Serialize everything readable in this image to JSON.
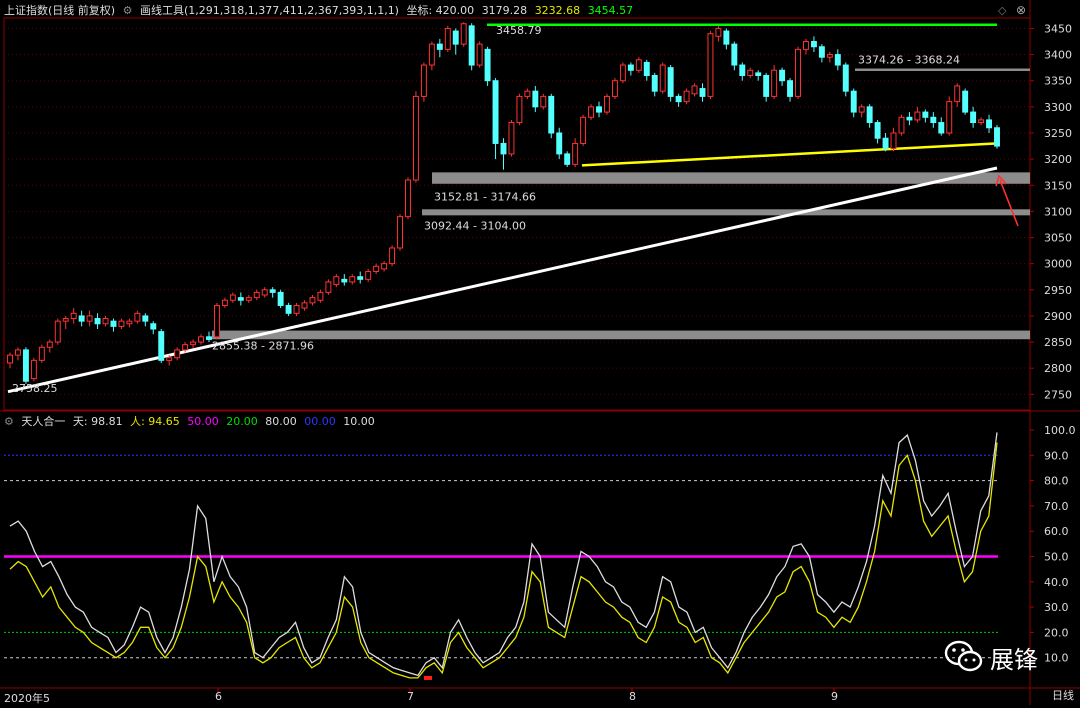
{
  "header": {
    "title": "上证指数(日线 前复权)",
    "tool": "画线工具(1,291,318,1,377,411,2,367,393,1,1,1)",
    "coord_label": "坐标: 420.00",
    "v1": "3179.28",
    "v2": "3232.68",
    "v3": "3454.57"
  },
  "indicator": {
    "name": "天人合一",
    "tian_label": "天: 98.81",
    "ren_label": "人: 94.65",
    "p50": "50.00",
    "p20": "20.00",
    "p80": "80.00",
    "p00": "00.00",
    "p10": "10.00"
  },
  "colors": {
    "up": "#ff3232",
    "down": "#54ffff",
    "tian": "#dddddd",
    "ren": "#e6e600",
    "magenta": "#ff00ff",
    "green": "#00ff00",
    "yellow": "#ffff00",
    "grey_band": "#8c8c8c"
  },
  "timeline": {
    "start": "2020年5",
    "labels": [
      "6",
      "7",
      "8",
      "9"
    ],
    "tab": "日线"
  },
  "watermark": "展锋",
  "chart_data": {
    "type": "candlestick",
    "price_ticks": [
      2750,
      2800,
      2850,
      2900,
      2950,
      3000,
      3050,
      3100,
      3150,
      3200,
      3250,
      3300,
      3350,
      3400,
      3450
    ],
    "price_range": [
      2720,
      3470
    ],
    "annotations": [
      {
        "text": "3458.79",
        "price": 3458.79
      },
      {
        "text": "3374.26 - 3368.24",
        "price": 3371
      },
      {
        "text": "3152.81 - 3174.66",
        "price": 3163
      },
      {
        "text": "3092.44 - 3104.00",
        "price": 3098
      },
      {
        "text": "2855.38 - 2871.96",
        "price": 2863
      },
      {
        "text": "2758.25",
        "price": 2758.25
      }
    ],
    "candles": [
      [
        2810,
        2825,
        2800,
        2830
      ],
      [
        2825,
        2835,
        2815,
        2840
      ],
      [
        2835,
        2775,
        2770,
        2840
      ],
      [
        2780,
        2815,
        2775,
        2820
      ],
      [
        2815,
        2840,
        2810,
        2845
      ],
      [
        2840,
        2850,
        2830,
        2855
      ],
      [
        2850,
        2890,
        2845,
        2895
      ],
      [
        2890,
        2895,
        2875,
        2900
      ],
      [
        2895,
        2905,
        2885,
        2915
      ],
      [
        2900,
        2890,
        2880,
        2910
      ],
      [
        2890,
        2900,
        2880,
        2910
      ],
      [
        2895,
        2885,
        2875,
        2905
      ],
      [
        2885,
        2895,
        2880,
        2900
      ],
      [
        2890,
        2880,
        2870,
        2895
      ],
      [
        2880,
        2890,
        2875,
        2895
      ],
      [
        2885,
        2890,
        2878,
        2895
      ],
      [
        2890,
        2905,
        2885,
        2910
      ],
      [
        2900,
        2890,
        2880,
        2905
      ],
      [
        2885,
        2875,
        2865,
        2890
      ],
      [
        2870,
        2815,
        2810,
        2875
      ],
      [
        2815,
        2820,
        2805,
        2825
      ],
      [
        2820,
        2835,
        2815,
        2840
      ],
      [
        2835,
        2845,
        2830,
        2850
      ],
      [
        2845,
        2850,
        2838,
        2855
      ],
      [
        2850,
        2860,
        2845,
        2865
      ],
      [
        2860,
        2855,
        2850,
        2870
      ],
      [
        2860,
        2920,
        2855,
        2925
      ],
      [
        2920,
        2930,
        2915,
        2935
      ],
      [
        2930,
        2940,
        2925,
        2945
      ],
      [
        2935,
        2930,
        2920,
        2945
      ],
      [
        2930,
        2935,
        2925,
        2940
      ],
      [
        2935,
        2945,
        2930,
        2950
      ],
      [
        2940,
        2950,
        2935,
        2955
      ],
      [
        2950,
        2945,
        2935,
        2955
      ],
      [
        2945,
        2920,
        2915,
        2950
      ],
      [
        2920,
        2905,
        2900,
        2925
      ],
      [
        2905,
        2920,
        2900,
        2925
      ],
      [
        2915,
        2925,
        2910,
        2930
      ],
      [
        2925,
        2935,
        2920,
        2940
      ],
      [
        2930,
        2945,
        2925,
        2950
      ],
      [
        2945,
        2965,
        2940,
        2970
      ],
      [
        2960,
        2975,
        2955,
        2980
      ],
      [
        2970,
        2965,
        2958,
        2980
      ],
      [
        2965,
        2975,
        2960,
        2980
      ],
      [
        2975,
        2970,
        2962,
        2985
      ],
      [
        2970,
        2985,
        2965,
        2990
      ],
      [
        2985,
        2995,
        2980,
        3000
      ],
      [
        2990,
        3000,
        2985,
        3005
      ],
      [
        3000,
        3030,
        2995,
        3035
      ],
      [
        3030,
        3090,
        3025,
        3095
      ],
      [
        3090,
        3160,
        3085,
        3165
      ],
      [
        3160,
        3320,
        3155,
        3330
      ],
      [
        3320,
        3380,
        3310,
        3385
      ],
      [
        3380,
        3420,
        3370,
        3425
      ],
      [
        3420,
        3410,
        3395,
        3430
      ],
      [
        3410,
        3450,
        3405,
        3455
      ],
      [
        3445,
        3420,
        3400,
        3450
      ],
      [
        3420,
        3459,
        3415,
        3462
      ],
      [
        3455,
        3380,
        3370,
        3460
      ],
      [
        3380,
        3420,
        3375,
        3425
      ],
      [
        3410,
        3350,
        3340,
        3415
      ],
      [
        3350,
        3230,
        3200,
        3355
      ],
      [
        3230,
        3210,
        3180,
        3240
      ],
      [
        3210,
        3270,
        3205,
        3275
      ],
      [
        3270,
        3320,
        3265,
        3325
      ],
      [
        3320,
        3330,
        3315,
        3335
      ],
      [
        3330,
        3300,
        3290,
        3340
      ],
      [
        3300,
        3320,
        3295,
        3325
      ],
      [
        3320,
        3250,
        3240,
        3325
      ],
      [
        3250,
        3210,
        3200,
        3260
      ],
      [
        3210,
        3190,
        3185,
        3215
      ],
      [
        3190,
        3230,
        3185,
        3240
      ],
      [
        3230,
        3280,
        3225,
        3285
      ],
      [
        3280,
        3300,
        3275,
        3305
      ],
      [
        3300,
        3290,
        3280,
        3310
      ],
      [
        3290,
        3320,
        3285,
        3325
      ],
      [
        3320,
        3350,
        3315,
        3355
      ],
      [
        3350,
        3380,
        3345,
        3385
      ],
      [
        3380,
        3370,
        3360,
        3385
      ],
      [
        3370,
        3390,
        3365,
        3395
      ],
      [
        3385,
        3360,
        3350,
        3390
      ],
      [
        3360,
        3330,
        3320,
        3365
      ],
      [
        3330,
        3380,
        3325,
        3385
      ],
      [
        3375,
        3320,
        3310,
        3380
      ],
      [
        3320,
        3310,
        3300,
        3325
      ],
      [
        3310,
        3330,
        3305,
        3335
      ],
      [
        3325,
        3340,
        3320,
        3345
      ],
      [
        3335,
        3320,
        3310,
        3345
      ],
      [
        3320,
        3440,
        3315,
        3445
      ],
      [
        3435,
        3450,
        3425,
        3455
      ],
      [
        3445,
        3420,
        3410,
        3450
      ],
      [
        3420,
        3380,
        3370,
        3425
      ],
      [
        3380,
        3360,
        3350,
        3385
      ],
      [
        3360,
        3370,
        3355,
        3375
      ],
      [
        3365,
        3360,
        3350,
        3370
      ],
      [
        3360,
        3320,
        3310,
        3365
      ],
      [
        3320,
        3370,
        3315,
        3380
      ],
      [
        3370,
        3350,
        3340,
        3375
      ],
      [
        3350,
        3320,
        3310,
        3355
      ],
      [
        3320,
        3410,
        3315,
        3415
      ],
      [
        3410,
        3425,
        3400,
        3430
      ],
      [
        3425,
        3415,
        3405,
        3435
      ],
      [
        3415,
        3395,
        3385,
        3420
      ],
      [
        3395,
        3400,
        3385,
        3405
      ],
      [
        3400,
        3380,
        3370,
        3410
      ],
      [
        3380,
        3330,
        3320,
        3385
      ],
      [
        3330,
        3290,
        3280,
        3335
      ],
      [
        3290,
        3300,
        3280,
        3305
      ],
      [
        3300,
        3270,
        3260,
        3305
      ],
      [
        3270,
        3240,
        3230,
        3275
      ],
      [
        3240,
        3220,
        3215,
        3250
      ],
      [
        3220,
        3250,
        3215,
        3260
      ],
      [
        3250,
        3280,
        3245,
        3285
      ],
      [
        3280,
        3275,
        3265,
        3290
      ],
      [
        3275,
        3290,
        3270,
        3300
      ],
      [
        3290,
        3280,
        3270,
        3295
      ],
      [
        3280,
        3270,
        3260,
        3290
      ],
      [
        3270,
        3250,
        3245,
        3280
      ],
      [
        3250,
        3310,
        3245,
        3320
      ],
      [
        3310,
        3340,
        3300,
        3345
      ],
      [
        3330,
        3290,
        3285,
        3335
      ],
      [
        3290,
        3270,
        3260,
        3300
      ],
      [
        3270,
        3275,
        3265,
        3280
      ],
      [
        3275,
        3260,
        3250,
        3285
      ],
      [
        3260,
        3225,
        3220,
        3265
      ]
    ],
    "tian": [
      62,
      64,
      60,
      52,
      46,
      48,
      42,
      35,
      30,
      28,
      22,
      20,
      18,
      12,
      15,
      22,
      30,
      28,
      18,
      12,
      18,
      30,
      45,
      70,
      65,
      40,
      50,
      42,
      38,
      30,
      12,
      10,
      14,
      18,
      20,
      24,
      14,
      8,
      10,
      18,
      25,
      42,
      38,
      20,
      12,
      10,
      8,
      6,
      5,
      4,
      3,
      8,
      10,
      6,
      20,
      25,
      18,
      12,
      8,
      10,
      12,
      18,
      22,
      32,
      55,
      50,
      28,
      25,
      22,
      38,
      52,
      50,
      46,
      40,
      38,
      32,
      30,
      24,
      22,
      28,
      42,
      40,
      30,
      28,
      20,
      22,
      14,
      10,
      6,
      12,
      20,
      26,
      30,
      35,
      42,
      46,
      54,
      55,
      50,
      35,
      32,
      28,
      32,
      30,
      38,
      48,
      62,
      82,
      75,
      95,
      98,
      88,
      72,
      66,
      70,
      75,
      60,
      46,
      50,
      68,
      74,
      99
    ],
    "ren": [
      45,
      48,
      46,
      40,
      34,
      38,
      30,
      26,
      22,
      20,
      16,
      14,
      12,
      10,
      12,
      16,
      22,
      22,
      14,
      10,
      14,
      22,
      34,
      50,
      46,
      32,
      40,
      34,
      30,
      24,
      10,
      8,
      10,
      14,
      16,
      18,
      10,
      6,
      8,
      14,
      20,
      34,
      30,
      16,
      10,
      8,
      6,
      4,
      3,
      2,
      2,
      6,
      8,
      4,
      16,
      20,
      14,
      10,
      6,
      8,
      10,
      14,
      18,
      26,
      44,
      40,
      22,
      20,
      18,
      30,
      42,
      40,
      36,
      32,
      30,
      26,
      24,
      18,
      16,
      22,
      34,
      32,
      24,
      22,
      16,
      18,
      10,
      8,
      4,
      10,
      16,
      20,
      24,
      28,
      34,
      36,
      44,
      46,
      40,
      28,
      26,
      22,
      26,
      24,
      30,
      40,
      52,
      72,
      66,
      86,
      90,
      80,
      64,
      58,
      62,
      66,
      52,
      40,
      44,
      60,
      66,
      95
    ]
  }
}
